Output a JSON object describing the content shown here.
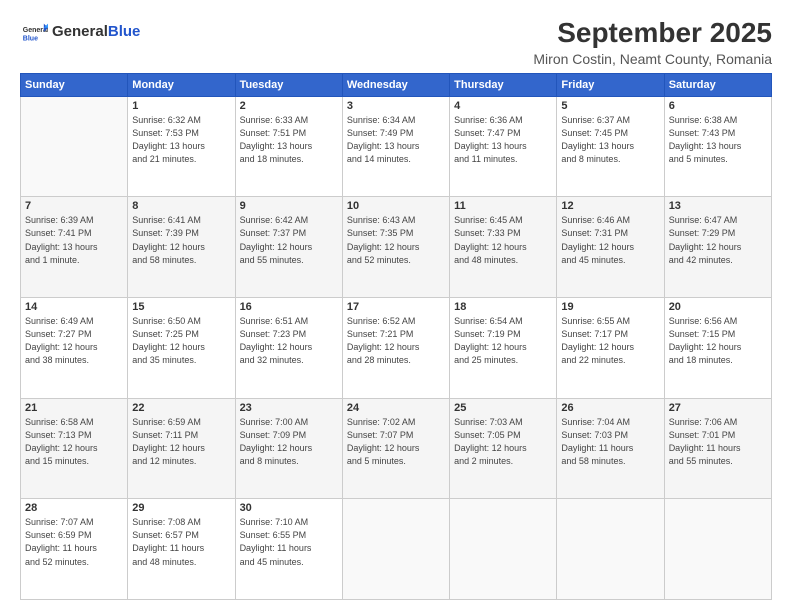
{
  "header": {
    "logo_general": "General",
    "logo_blue": "Blue",
    "month": "September 2025",
    "location": "Miron Costin, Neamt County, Romania"
  },
  "weekdays": [
    "Sunday",
    "Monday",
    "Tuesday",
    "Wednesday",
    "Thursday",
    "Friday",
    "Saturday"
  ],
  "weeks": [
    [
      {
        "day": "",
        "detail": ""
      },
      {
        "day": "1",
        "detail": "Sunrise: 6:32 AM\nSunset: 7:53 PM\nDaylight: 13 hours\nand 21 minutes."
      },
      {
        "day": "2",
        "detail": "Sunrise: 6:33 AM\nSunset: 7:51 PM\nDaylight: 13 hours\nand 18 minutes."
      },
      {
        "day": "3",
        "detail": "Sunrise: 6:34 AM\nSunset: 7:49 PM\nDaylight: 13 hours\nand 14 minutes."
      },
      {
        "day": "4",
        "detail": "Sunrise: 6:36 AM\nSunset: 7:47 PM\nDaylight: 13 hours\nand 11 minutes."
      },
      {
        "day": "5",
        "detail": "Sunrise: 6:37 AM\nSunset: 7:45 PM\nDaylight: 13 hours\nand 8 minutes."
      },
      {
        "day": "6",
        "detail": "Sunrise: 6:38 AM\nSunset: 7:43 PM\nDaylight: 13 hours\nand 5 minutes."
      }
    ],
    [
      {
        "day": "7",
        "detail": "Sunrise: 6:39 AM\nSunset: 7:41 PM\nDaylight: 13 hours\nand 1 minute."
      },
      {
        "day": "8",
        "detail": "Sunrise: 6:41 AM\nSunset: 7:39 PM\nDaylight: 12 hours\nand 58 minutes."
      },
      {
        "day": "9",
        "detail": "Sunrise: 6:42 AM\nSunset: 7:37 PM\nDaylight: 12 hours\nand 55 minutes."
      },
      {
        "day": "10",
        "detail": "Sunrise: 6:43 AM\nSunset: 7:35 PM\nDaylight: 12 hours\nand 52 minutes."
      },
      {
        "day": "11",
        "detail": "Sunrise: 6:45 AM\nSunset: 7:33 PM\nDaylight: 12 hours\nand 48 minutes."
      },
      {
        "day": "12",
        "detail": "Sunrise: 6:46 AM\nSunset: 7:31 PM\nDaylight: 12 hours\nand 45 minutes."
      },
      {
        "day": "13",
        "detail": "Sunrise: 6:47 AM\nSunset: 7:29 PM\nDaylight: 12 hours\nand 42 minutes."
      }
    ],
    [
      {
        "day": "14",
        "detail": "Sunrise: 6:49 AM\nSunset: 7:27 PM\nDaylight: 12 hours\nand 38 minutes."
      },
      {
        "day": "15",
        "detail": "Sunrise: 6:50 AM\nSunset: 7:25 PM\nDaylight: 12 hours\nand 35 minutes."
      },
      {
        "day": "16",
        "detail": "Sunrise: 6:51 AM\nSunset: 7:23 PM\nDaylight: 12 hours\nand 32 minutes."
      },
      {
        "day": "17",
        "detail": "Sunrise: 6:52 AM\nSunset: 7:21 PM\nDaylight: 12 hours\nand 28 minutes."
      },
      {
        "day": "18",
        "detail": "Sunrise: 6:54 AM\nSunset: 7:19 PM\nDaylight: 12 hours\nand 25 minutes."
      },
      {
        "day": "19",
        "detail": "Sunrise: 6:55 AM\nSunset: 7:17 PM\nDaylight: 12 hours\nand 22 minutes."
      },
      {
        "day": "20",
        "detail": "Sunrise: 6:56 AM\nSunset: 7:15 PM\nDaylight: 12 hours\nand 18 minutes."
      }
    ],
    [
      {
        "day": "21",
        "detail": "Sunrise: 6:58 AM\nSunset: 7:13 PM\nDaylight: 12 hours\nand 15 minutes."
      },
      {
        "day": "22",
        "detail": "Sunrise: 6:59 AM\nSunset: 7:11 PM\nDaylight: 12 hours\nand 12 minutes."
      },
      {
        "day": "23",
        "detail": "Sunrise: 7:00 AM\nSunset: 7:09 PM\nDaylight: 12 hours\nand 8 minutes."
      },
      {
        "day": "24",
        "detail": "Sunrise: 7:02 AM\nSunset: 7:07 PM\nDaylight: 12 hours\nand 5 minutes."
      },
      {
        "day": "25",
        "detail": "Sunrise: 7:03 AM\nSunset: 7:05 PM\nDaylight: 12 hours\nand 2 minutes."
      },
      {
        "day": "26",
        "detail": "Sunrise: 7:04 AM\nSunset: 7:03 PM\nDaylight: 11 hours\nand 58 minutes."
      },
      {
        "day": "27",
        "detail": "Sunrise: 7:06 AM\nSunset: 7:01 PM\nDaylight: 11 hours\nand 55 minutes."
      }
    ],
    [
      {
        "day": "28",
        "detail": "Sunrise: 7:07 AM\nSunset: 6:59 PM\nDaylight: 11 hours\nand 52 minutes."
      },
      {
        "day": "29",
        "detail": "Sunrise: 7:08 AM\nSunset: 6:57 PM\nDaylight: 11 hours\nand 48 minutes."
      },
      {
        "day": "30",
        "detail": "Sunrise: 7:10 AM\nSunset: 6:55 PM\nDaylight: 11 hours\nand 45 minutes."
      },
      {
        "day": "",
        "detail": ""
      },
      {
        "day": "",
        "detail": ""
      },
      {
        "day": "",
        "detail": ""
      },
      {
        "day": "",
        "detail": ""
      }
    ]
  ]
}
